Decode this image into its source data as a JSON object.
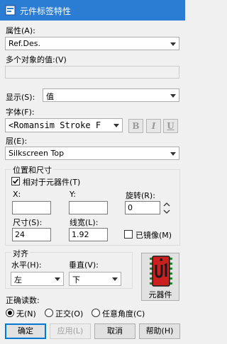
{
  "window": {
    "title": "元件标签特性"
  },
  "attribute": {
    "label": "属性(A):",
    "value": "Ref.Des."
  },
  "multi_value": {
    "label": "多个对象的值:(V)",
    "value": ""
  },
  "display": {
    "label": "显示(S):",
    "value": "值"
  },
  "font": {
    "label": "字体(F):",
    "value": "<Romansim Stroke F",
    "bold": "B",
    "italic": "I",
    "underline": "U"
  },
  "layer": {
    "label": "层(E):",
    "value": "Silkscreen Top"
  },
  "position": {
    "group_label": "位置和尺寸",
    "relative_label": "相对于元器件(T)",
    "relative_checked": true,
    "x_label": "X:",
    "x_value": "",
    "y_label": "Y:",
    "y_value": "",
    "rotation_label": "旋转(R):",
    "rotation_value": "0",
    "size_label": "尺寸(S):",
    "size_value": "24",
    "width_label": "线宽(L):",
    "width_value": "1.92",
    "mirror_label": "已镜像(M)",
    "mirror_checked": false
  },
  "align": {
    "group_label": "对齐",
    "horizontal_label": "水平(H):",
    "horizontal_value": "左",
    "vertical_label": "垂直(V):",
    "vertical_value": "下"
  },
  "component_button": {
    "label": "元器件"
  },
  "reading": {
    "label": "正确读数:",
    "options": [
      "无(N)",
      "正交(O)",
      "任意角度(C)"
    ],
    "selected": 0
  },
  "buttons": {
    "ok": "确定",
    "apply": "应用(L)",
    "cancel": "取消",
    "help": "帮助(H)"
  },
  "colors": {
    "titlebar": "#2b7cd3",
    "accent": "#0078d7",
    "chip_red": "#cc1f1f"
  }
}
